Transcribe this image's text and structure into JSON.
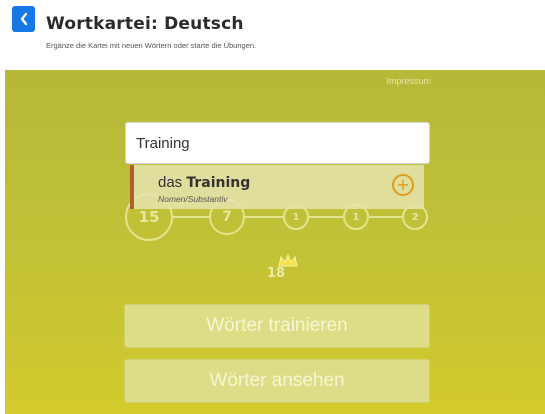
{
  "header": {
    "title": "Wortkartei: Deutsch",
    "subtitle": "Ergänze die Kartei mit neuen Wörtern oder starte die Übungen."
  },
  "panel": {
    "impressum": "Impressum"
  },
  "search": {
    "value": "Training"
  },
  "suggestion": {
    "article": "das",
    "word": "Training",
    "type": "Nomen/Substantiv",
    "add_symbol": "+"
  },
  "progress": {
    "stages": [
      "15",
      "7",
      "1",
      "1",
      "2"
    ],
    "total": "18"
  },
  "actions": {
    "train_label": "Wörter trainieren",
    "view_label": "Wörter ansehen"
  },
  "colors": {
    "accent": "#1877e6",
    "add": "#e19b1e",
    "marker": "#b35d2b"
  }
}
